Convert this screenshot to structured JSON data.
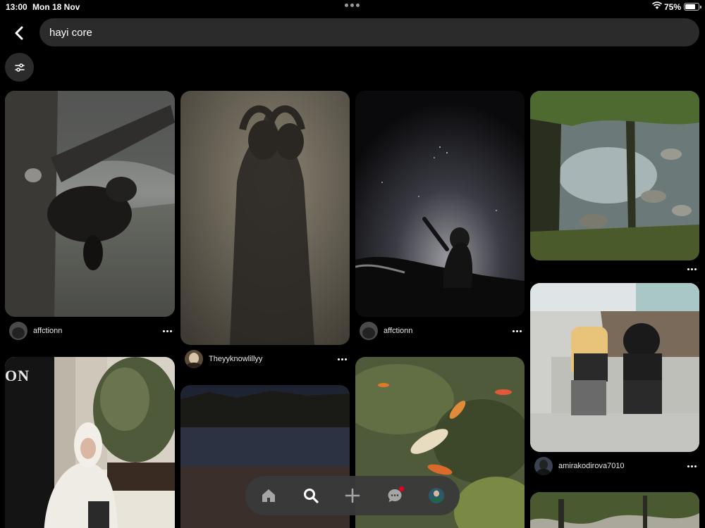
{
  "status_bar": {
    "time": "13:00",
    "date": "Mon 18 Nov",
    "battery": "75%",
    "battery_level": 0.75
  },
  "search": {
    "query": "hayi core"
  },
  "icons": {
    "back": "chevron-left-icon",
    "filter": "sliders-icon",
    "more": "more-horizontal-icon",
    "home": "home-icon",
    "search": "search-icon",
    "create": "plus-icon",
    "messages": "chat-bubble-icon",
    "profile": "profile-avatar-icon"
  },
  "pins": [
    {
      "author": "affctionn"
    },
    {
      "author": "Theyyknowlillyy"
    },
    {
      "author": "affctionn"
    },
    {
      "author": ""
    },
    {
      "author": "amirakodirova7010"
    },
    {
      "author": ""
    },
    {
      "author": ""
    },
    {
      "author": ""
    },
    {
      "author": ""
    }
  ],
  "pin_texts": {
    "storefront_letters": "ON"
  },
  "colors": {
    "background": "#000000",
    "search_bg": "#2b2b2b",
    "notification": "#e60023"
  }
}
